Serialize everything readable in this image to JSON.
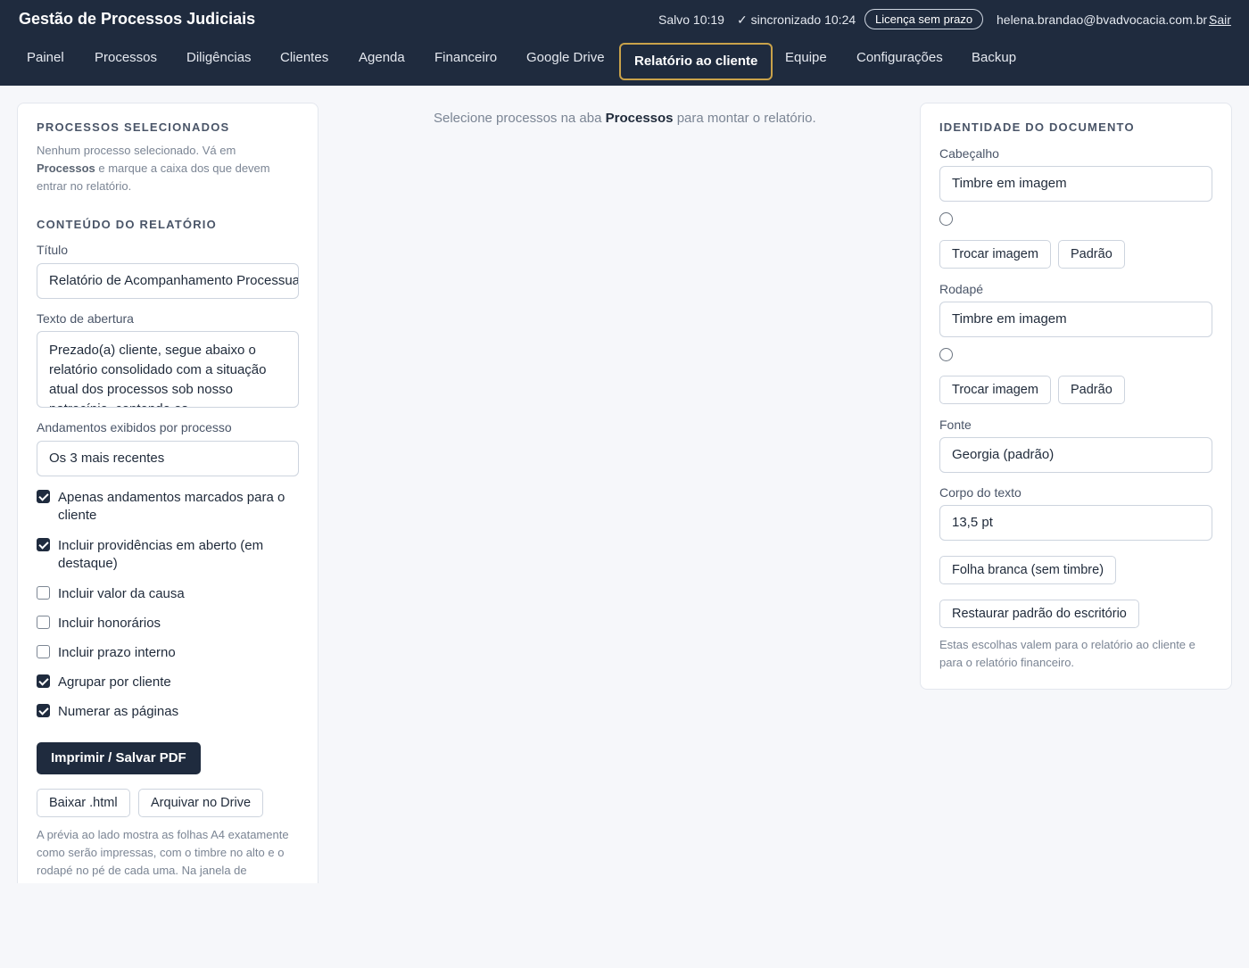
{
  "app": {
    "title": "Gestão de Processos Judiciais"
  },
  "status": {
    "saved": "Salvo 10:19",
    "synced": "✓ sincronizado 10:24",
    "license": "Licença sem prazo",
    "user_email": "helena.brandao@bvadvocacia.com.br ·",
    "logout": "Sair"
  },
  "nav": {
    "items": [
      {
        "label": "Painel"
      },
      {
        "label": "Processos"
      },
      {
        "label": "Diligências"
      },
      {
        "label": "Clientes"
      },
      {
        "label": "Agenda"
      },
      {
        "label": "Financeiro"
      },
      {
        "label": "Google Drive"
      },
      {
        "label": "Relatório ao cliente",
        "active": true
      },
      {
        "label": "Equipe"
      },
      {
        "label": "Configurações"
      },
      {
        "label": "Backup"
      }
    ]
  },
  "left_panel": {
    "selected_heading": "PROCESSOS SELECIONADOS",
    "selected_msg_part1": "Nenhum processo selecionado. Vá em",
    "selected_msg_bold": "Processos",
    "selected_msg_part2": "e marque a caixa dos que devem entrar no relatório.",
    "content_heading": "CONTEÚDO DO RELATÓRIO",
    "title_label": "Título",
    "title_value": "Relatório de Acompanhamento Processual",
    "opening_label": "Texto de abertura",
    "opening_value": "Prezado(a) cliente, segue abaixo o relatório consolidado com a situação atual dos processos sob nosso patrocínio, contendo os",
    "moves_label": "Andamentos exibidos por processo",
    "moves_value": "Os 3 mais recentes",
    "options": [
      {
        "label": "Apenas andamentos marcados para o cliente",
        "checked": true
      },
      {
        "label": "Incluir providências em aberto (em destaque)",
        "checked": true
      },
      {
        "label": "Incluir valor da causa",
        "checked": false
      },
      {
        "label": "Incluir honorários",
        "checked": false
      },
      {
        "label": "Incluir prazo interno",
        "checked": false
      },
      {
        "label": "Agrupar por cliente",
        "checked": true
      },
      {
        "label": "Numerar as páginas",
        "checked": true
      }
    ],
    "print_button": "Imprimir / Salvar PDF",
    "download_button": "Baixar .html",
    "archive_button": "Arquivar no Drive",
    "footer_note": "A prévia ao lado mostra as folhas A4 exatamente como serão impressas, com o timbre no alto e o rodapé no pé de cada uma. Na janela de"
  },
  "center": {
    "msg_part1": "Selecione processos na aba",
    "msg_bold": "Processos",
    "msg_part2": "para montar o relatório."
  },
  "right_panel": {
    "heading": "IDENTIDADE DO DOCUMENTO",
    "header_label": "Cabeçalho",
    "header_value": "Timbre em imagem",
    "footer_label": "Rodapé",
    "footer_value": "Timbre em imagem",
    "change_image": "Trocar imagem",
    "default_button": "Padrão",
    "font_label": "Fonte",
    "font_value": "Georgia (padrão)",
    "body_label": "Corpo do texto",
    "body_value": "13,5 pt",
    "blank_sheet_button": "Folha branca (sem timbre)",
    "restore_button": "Restaurar padrão do escritório",
    "note": "Estas escolhas valem para o relatório ao cliente e para o relatório financeiro."
  }
}
